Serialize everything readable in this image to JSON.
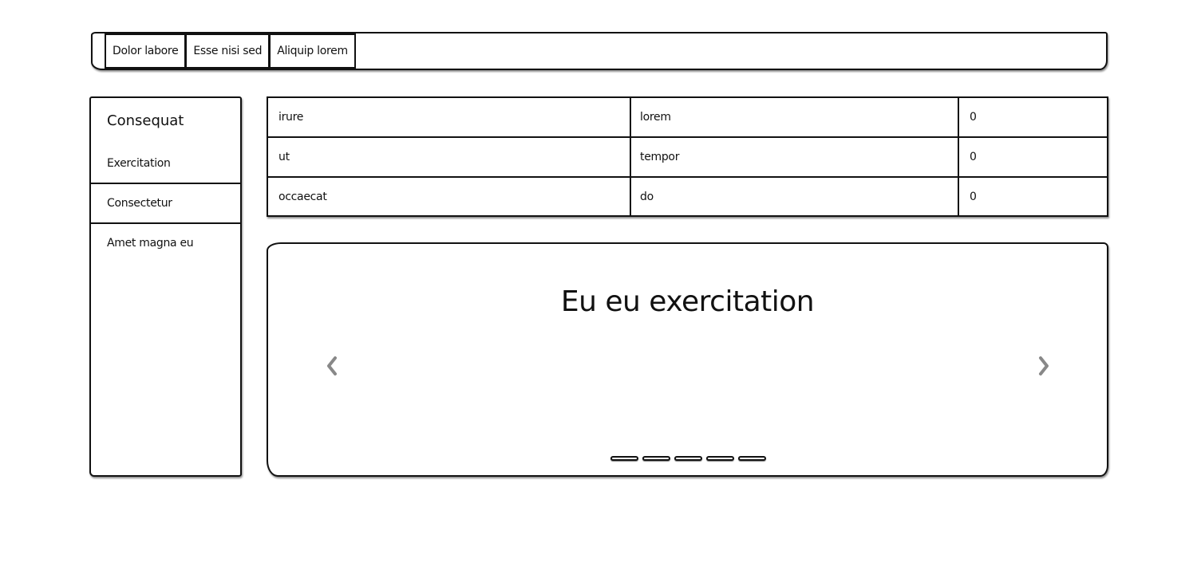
{
  "topbar": {
    "tabs": [
      {
        "label": "Dolor labore"
      },
      {
        "label": "Esse nisi sed"
      },
      {
        "label": "Aliquip lorem"
      }
    ]
  },
  "sidebar": {
    "title": "Consequat",
    "items": [
      {
        "label": "Exercitation"
      },
      {
        "label": "Consectetur"
      },
      {
        "label": "Amet magna eu"
      }
    ]
  },
  "table": {
    "rows": [
      [
        "irure",
        "lorem",
        "0"
      ],
      [
        "ut",
        "tempor",
        "0"
      ],
      [
        "occaecat",
        "do",
        "0"
      ]
    ]
  },
  "carousel": {
    "title": "Eu eu exercitation",
    "prev_icon": "chevron-left-icon",
    "next_icon": "chevron-right-icon",
    "slide_count": 5
  },
  "colors": {
    "border": "#111111",
    "arrow": "#888888",
    "background": "#ffffff"
  }
}
